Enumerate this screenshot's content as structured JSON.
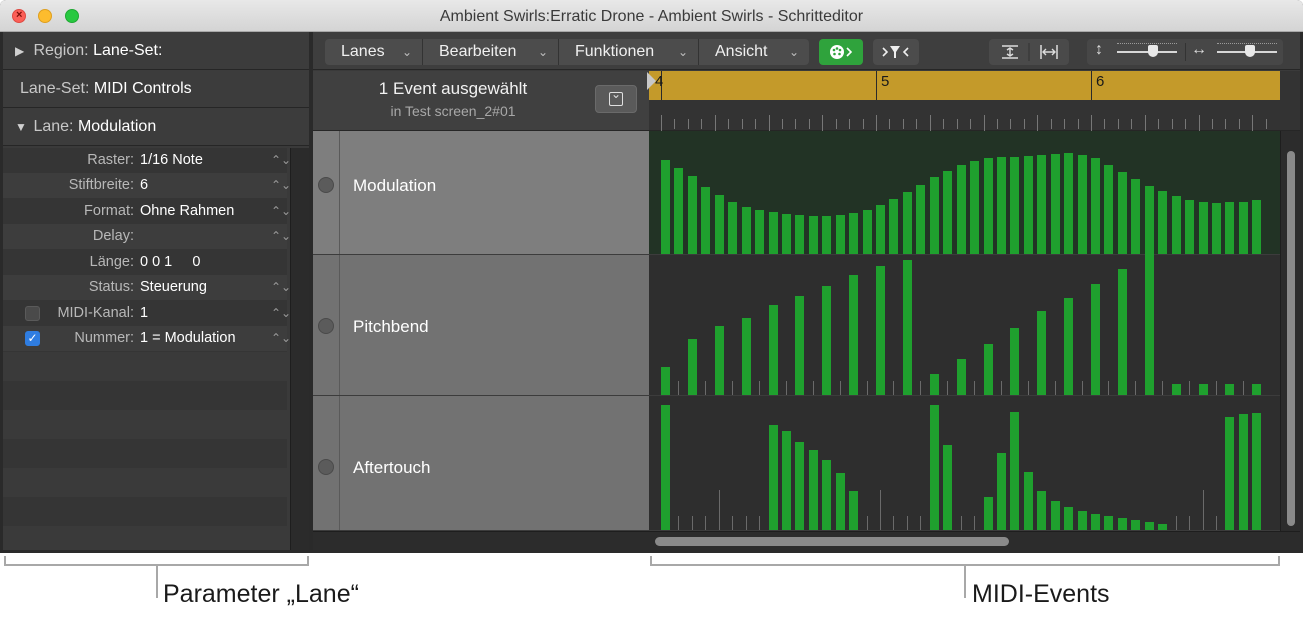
{
  "window": {
    "title": "Ambient Swirls:Erratic Drone - Ambient Swirls - Schritteditor"
  },
  "inspector": {
    "region": {
      "label": "Region:",
      "value": "Lane-Set:"
    },
    "laneset": {
      "label": "Lane-Set:",
      "value": "MIDI Controls"
    },
    "lane": {
      "label": "Lane:",
      "value": "Modulation"
    },
    "params": {
      "raster": {
        "label": "Raster:",
        "value": "1/16 Note"
      },
      "stiftbreite": {
        "label": "Stiftbreite:",
        "value": "6"
      },
      "format": {
        "label": "Format:",
        "value": "Ohne Rahmen"
      },
      "delay": {
        "label": "Delay:",
        "value": ""
      },
      "laenge": {
        "label": "Länge:",
        "value": "0 0 1     0"
      },
      "status": {
        "label": "Status:",
        "value": "Steuerung"
      },
      "midikanal": {
        "label": "MIDI-Kanal:",
        "value": "1",
        "checked": false
      },
      "nummer": {
        "label": "Nummer:",
        "value": "1 = Modulation",
        "checked": true
      }
    }
  },
  "toolbar": {
    "menus": [
      "Lanes",
      "Bearbeiten",
      "Funktionen",
      "Ansicht"
    ],
    "icons": [
      "midi-in-icon",
      "filter-icon",
      "vertical-fit-icon",
      "horizontal-fit-icon",
      "vertical-zoom-icon",
      "horizontal-zoom-icon"
    ],
    "vzoom_level": 0.6,
    "hzoom_level": 0.55
  },
  "editor": {
    "selection_count": "1 Event ausgewählt",
    "selection_region": "in Test screen_2#01",
    "bars": [
      "4",
      "5",
      "6"
    ],
    "lanes": [
      {
        "name": "Modulation",
        "selected": true,
        "values": [
          100,
          92,
          83,
          72,
          63,
          56,
          50,
          47,
          45,
          43,
          42,
          41,
          41,
          42,
          44,
          47,
          52,
          59,
          66,
          74,
          82,
          89,
          95,
          99,
          102,
          103,
          104,
          105,
          106,
          107,
          108,
          106,
          102,
          95,
          87,
          80,
          73,
          67,
          62,
          58,
          55,
          54,
          55,
          56,
          58
        ]
      },
      {
        "name": "Pitchbend",
        "selected": false,
        "values": [
          26,
          0,
          52,
          0,
          64,
          0,
          72,
          0,
          84,
          0,
          92,
          0,
          102,
          0,
          112,
          0,
          120,
          0,
          126,
          0,
          20,
          0,
          34,
          0,
          48,
          0,
          63,
          0,
          78,
          0,
          91,
          0,
          104,
          0,
          118,
          0,
          132,
          0,
          10,
          0,
          10,
          0,
          10,
          0,
          10
        ]
      },
      {
        "name": "Aftertouch",
        "selected": false,
        "values": [
          122,
          0,
          0,
          0,
          0,
          0,
          0,
          0,
          103,
          97,
          86,
          78,
          68,
          56,
          38,
          0,
          0,
          0,
          0,
          0,
          122,
          83,
          0,
          0,
          32,
          75,
          115,
          57,
          38,
          28,
          22,
          19,
          16,
          14,
          12,
          10,
          8,
          6,
          0,
          0,
          0,
          0,
          110,
          113,
          114
        ]
      }
    ]
  },
  "callouts": {
    "left": "Parameter „Lane“",
    "right": "MIDI-Events"
  }
}
